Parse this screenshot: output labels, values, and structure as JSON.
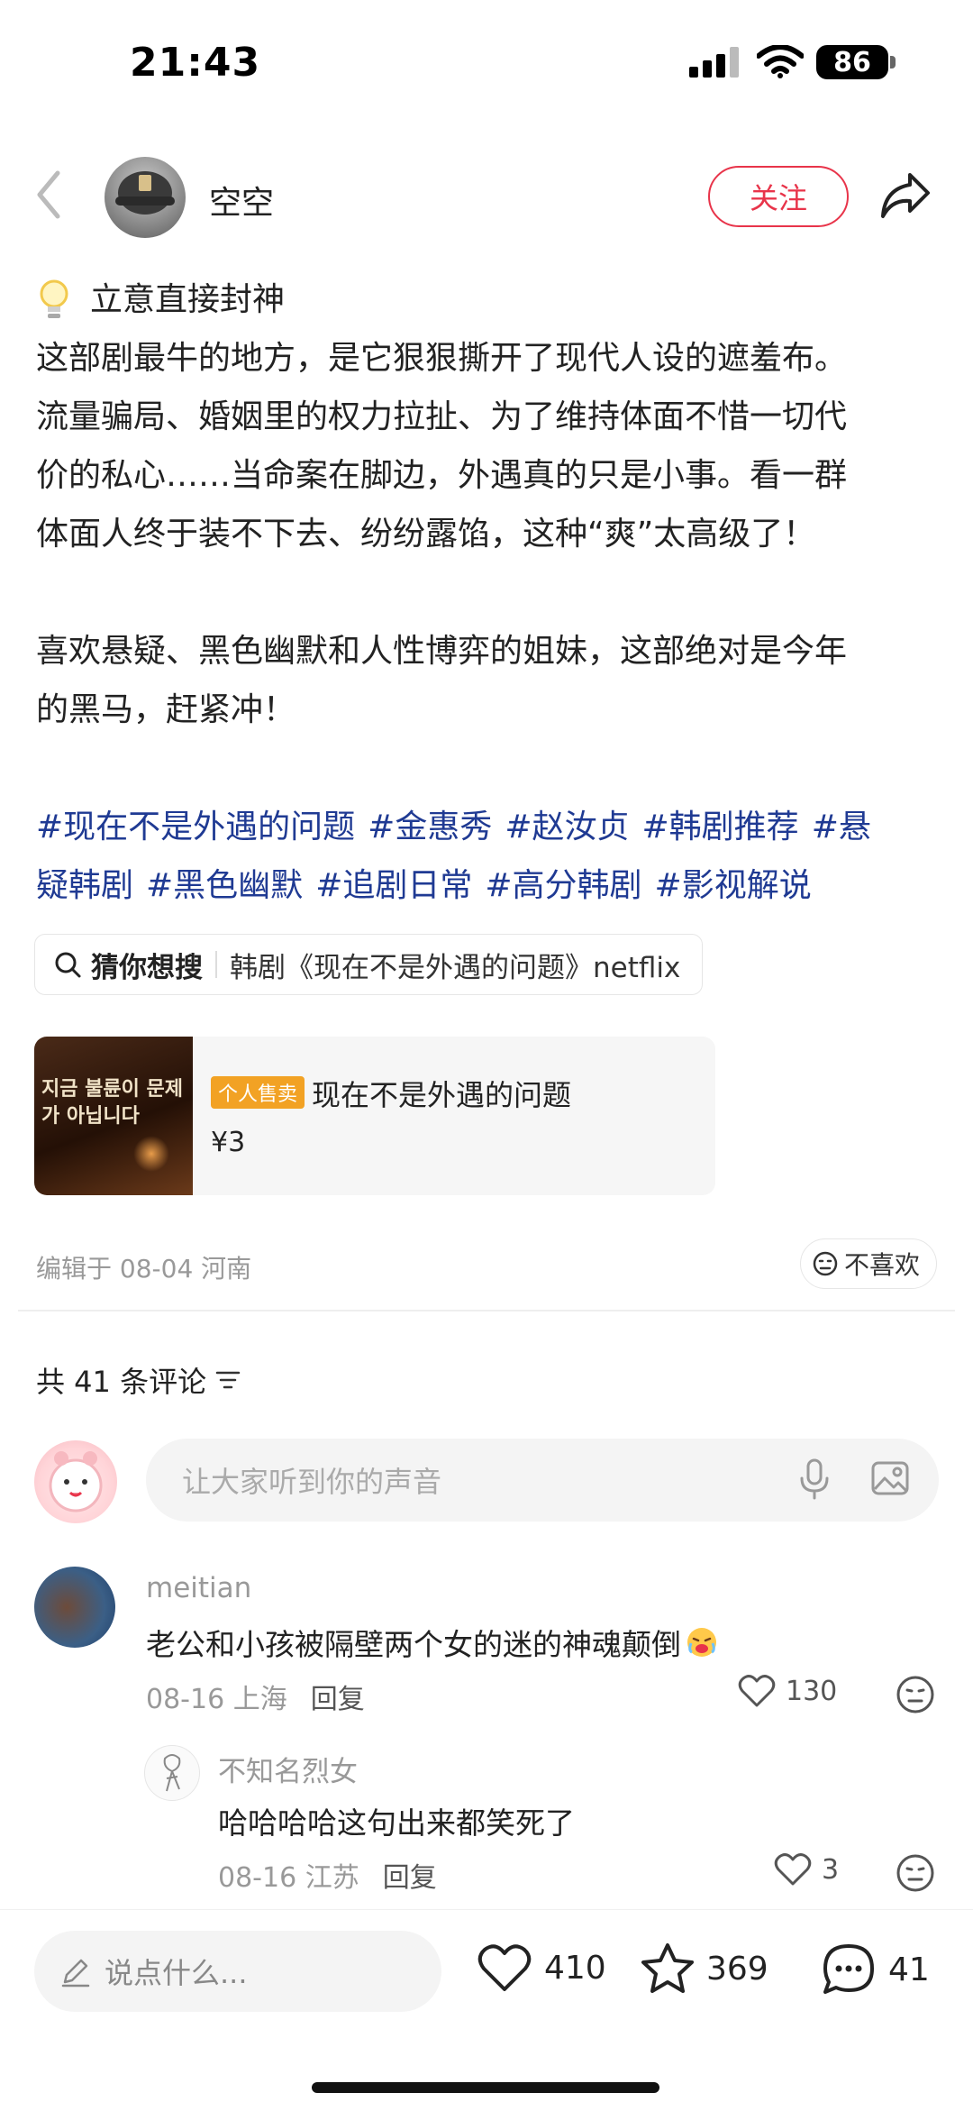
{
  "status_bar": {
    "time": "21:43",
    "battery": "86"
  },
  "header": {
    "author": "空空",
    "follow_label": "关注"
  },
  "post": {
    "title": "立意直接封神",
    "paragraph1_lines": [
      "这部剧最牛的地方，是它狠狠撕开了现代人设的遮羞布。",
      "流量骗局、婚姻里的权力拉扯、为了维持体面不惜一切代",
      "价的私心……当命案在脚边，外遇真的只是小事。看一群",
      "体面人终于装不下去、纷纷露馅，这种“爽”太高级了！"
    ],
    "paragraph2_lines": [
      "喜欢悬疑、黑色幽默和人性博弈的姐妹，这部绝对是今年",
      "的黑马，赶紧冲！"
    ],
    "tags_line1": [
      "#现在不是外遇的问题",
      "#金惠秀",
      "#赵汝贞",
      "#韩剧推荐",
      "#悬"
    ],
    "tags_line2": [
      "疑韩剧",
      "#黑色幽默",
      "#追剧日常",
      "#高分韩剧",
      "#影视解说"
    ]
  },
  "guess_search": {
    "label": "猜你想搜",
    "query": "韩剧《现在不是外遇的问题》netflix"
  },
  "product": {
    "badge": "个人售卖",
    "name": "现在不是外遇的问题",
    "price": "¥3",
    "poster_text": "지금 불륜이 문제가 아닙니다"
  },
  "meta": {
    "edited": "编辑于 08-04 河南",
    "dislike_label": "不喜欢"
  },
  "comments_section": {
    "count_label": "共 41 条评论",
    "input_placeholder": "让大家听到你的声音"
  },
  "comments": [
    {
      "user": "meitian",
      "text": "老公和小孩被隔壁两个女的迷的神魂颠倒",
      "date_loc": "08-16 上海",
      "reply_label": "回复",
      "likes": "130"
    },
    {
      "user": "不知名烈女",
      "text": "哈哈哈哈这句出来都笑死了",
      "date_loc": "08-16 江苏",
      "reply_label": "回复",
      "likes": "3"
    }
  ],
  "bottom_bar": {
    "say_placeholder": "说点什么...",
    "likes": "410",
    "favorites": "369",
    "comments": "41"
  },
  "colors": {
    "accent": "#e8344a",
    "tag": "#1f3a93",
    "badge": "#f2a224"
  }
}
